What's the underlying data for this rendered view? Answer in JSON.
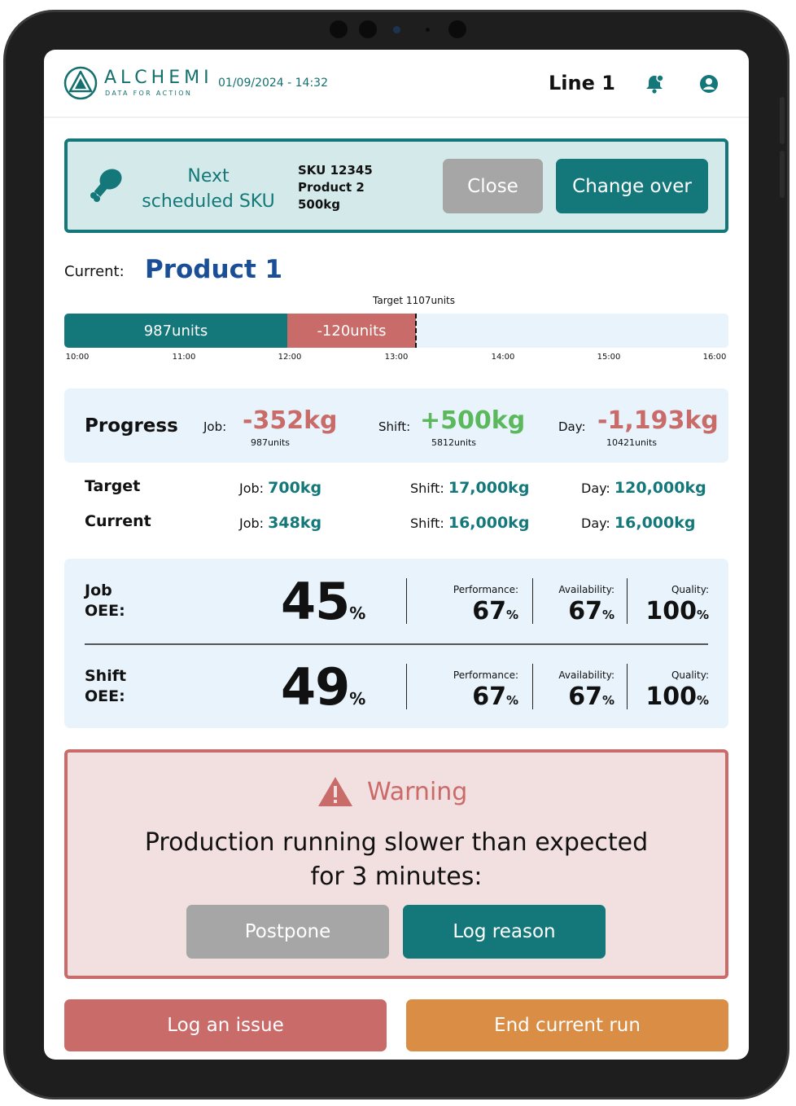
{
  "header": {
    "logo_word": "ALCHEMI",
    "logo_tagline": "DATA FOR ACTION",
    "datetime": "01/09/2024 - 14:32",
    "line_title": "Line 1"
  },
  "next_sku": {
    "heading_line1": "Next",
    "heading_line2": "scheduled SKU",
    "sku": "SKU 12345",
    "product": "Product 2",
    "weight": "500kg",
    "close_label": "Close",
    "changeover_label": "Change over"
  },
  "current": {
    "label": "Current:",
    "product": "Product 1",
    "target_label": "Target 1107units",
    "done_label": "987units",
    "behind_label": "-120units",
    "ticks": [
      "10:00",
      "11:00",
      "12:00",
      "13:00",
      "14:00",
      "15:00",
      "16:00"
    ]
  },
  "progress": {
    "title": "Progress",
    "job_label": "Job:",
    "job_value": "-352kg",
    "job_units": "987units",
    "shift_label": "Shift:",
    "shift_value": "+500kg",
    "shift_units": "5812units",
    "day_label": "Day:",
    "day_value": "-1,193kg",
    "day_units": "10421units"
  },
  "targets": {
    "target_heading": "Target",
    "current_heading": "Current",
    "job_label": "Job:",
    "shift_label": "Shift:",
    "day_label": "Day:",
    "target_job": "700kg",
    "target_shift": "17,000kg",
    "target_day": "120,000kg",
    "current_job": "348kg",
    "current_shift": "16,000kg",
    "current_day": "16,000kg"
  },
  "oee": {
    "percent": "%",
    "performance_label": "Performance:",
    "availability_label": "Availability:",
    "quality_label": "Quality:",
    "job": {
      "title_line1": "Job",
      "title_line2": "OEE:",
      "value": "45",
      "performance": "67",
      "availability": "67",
      "quality": "100"
    },
    "shift": {
      "title_line1": "Shift",
      "title_line2": "OEE:",
      "value": "49",
      "performance": "67",
      "availability": "67",
      "quality": "100"
    }
  },
  "warning": {
    "title": "Warning",
    "message_line1": "Production running slower than expected",
    "message_line2": "for 3 minutes:",
    "postpone_label": "Postpone",
    "log_reason_label": "Log reason"
  },
  "actions": {
    "log_issue_label": "Log an issue",
    "end_run_label": "End current run"
  },
  "colors": {
    "teal": "#14787a",
    "brand_blue": "#1a4f97",
    "negative": "#c96b69",
    "positive": "#5cb85c",
    "orange": "#d98d45",
    "panel_blue": "#e8f3fb"
  }
}
